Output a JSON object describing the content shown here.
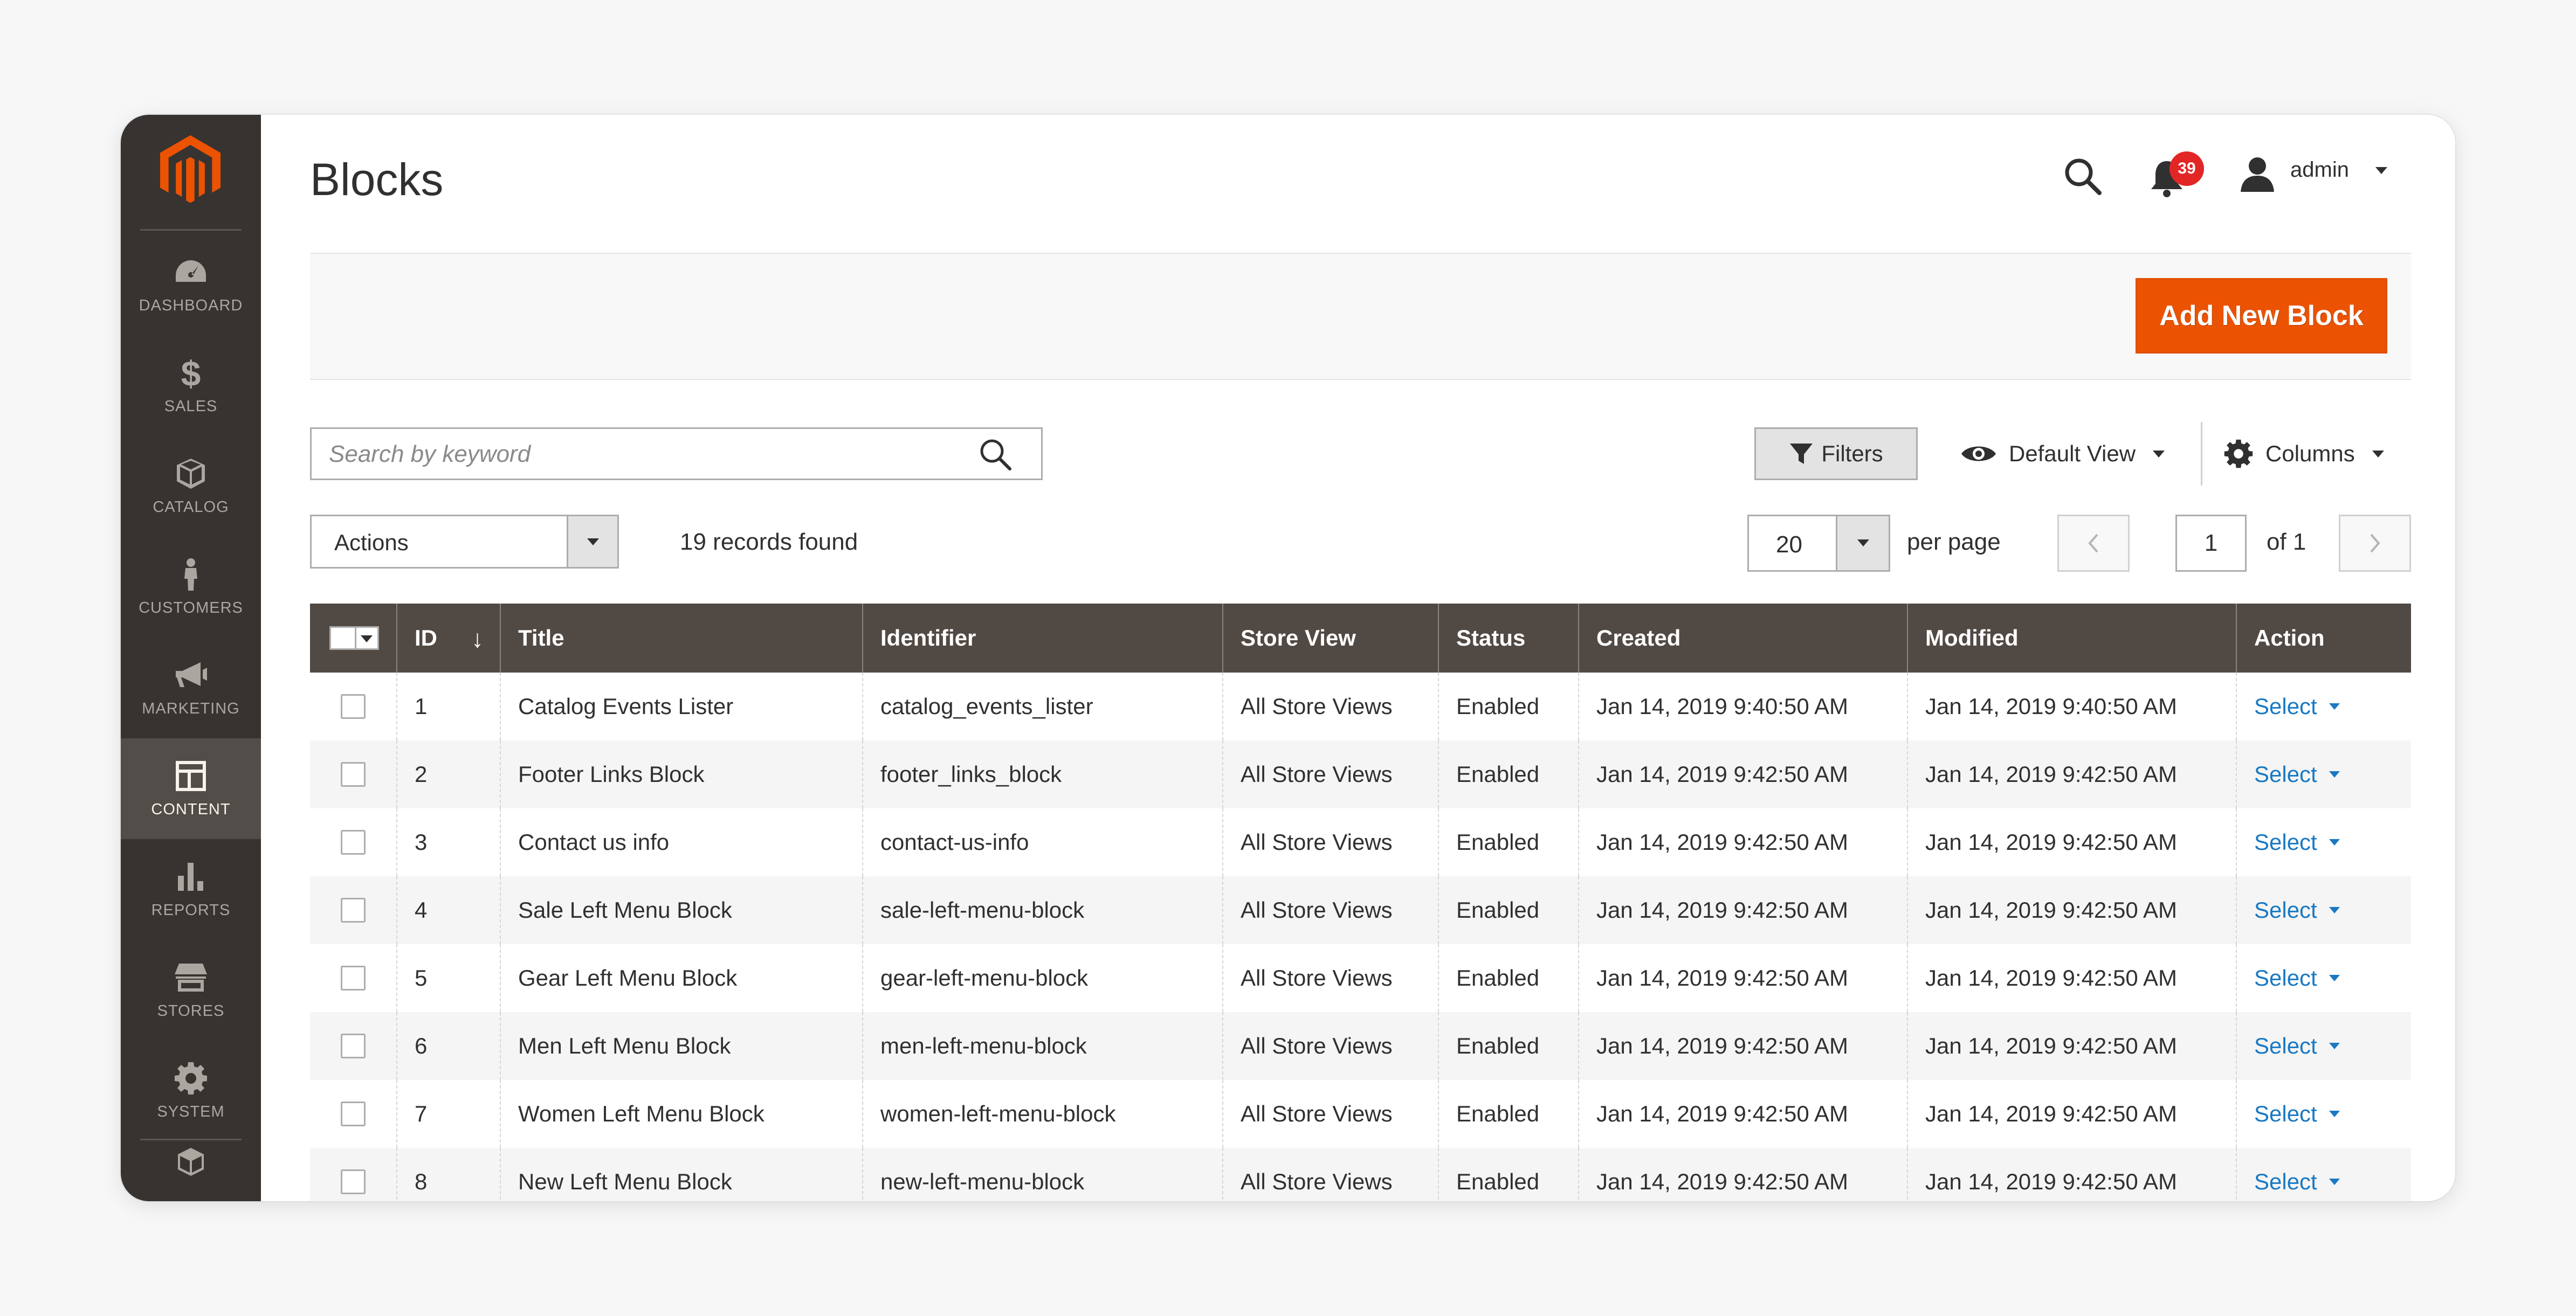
{
  "sidebar": {
    "items": [
      {
        "label": "DASHBOARD",
        "icon": "dashboard-icon"
      },
      {
        "label": "SALES",
        "icon": "dollar-icon"
      },
      {
        "label": "CATALOG",
        "icon": "cube-icon"
      },
      {
        "label": "CUSTOMERS",
        "icon": "person-icon"
      },
      {
        "label": "MARKETING",
        "icon": "megaphone-icon"
      },
      {
        "label": "CONTENT",
        "icon": "layout-icon",
        "active": true
      },
      {
        "label": "REPORTS",
        "icon": "bar-chart-icon"
      },
      {
        "label": "STORES",
        "icon": "storefront-icon"
      },
      {
        "label": "SYSTEM",
        "icon": "gear-icon"
      }
    ]
  },
  "header": {
    "title": "Blocks",
    "notification_count": "39",
    "username": "admin"
  },
  "page_actions": {
    "add_button": "Add New Block"
  },
  "toolbar": {
    "search_placeholder": "Search by keyword",
    "filters_label": "Filters",
    "view_label": "Default View",
    "columns_label": "Columns",
    "actions_label": "Actions",
    "records_found": "19 records found",
    "per_page_value": "20",
    "per_page_label": "per page",
    "page_number": "1",
    "page_of": "of 1"
  },
  "grid": {
    "columns": [
      "ID",
      "Title",
      "Identifier",
      "Store View",
      "Status",
      "Created",
      "Modified",
      "Action"
    ],
    "rows": [
      {
        "id": "1",
        "title": "Catalog Events Lister",
        "identifier": "catalog_events_lister",
        "store_view": "All Store Views",
        "status": "Enabled",
        "created": "Jan 14, 2019 9:40:50 AM",
        "modified": "Jan 14, 2019 9:40:50 AM",
        "action": "Select"
      },
      {
        "id": "2",
        "title": "Footer Links Block",
        "identifier": "footer_links_block",
        "store_view": "All Store Views",
        "status": "Enabled",
        "created": "Jan 14, 2019 9:42:50 AM",
        "modified": "Jan 14, 2019 9:42:50 AM",
        "action": "Select"
      },
      {
        "id": "3",
        "title": "Contact us info",
        "identifier": "contact-us-info",
        "store_view": "All Store Views",
        "status": "Enabled",
        "created": "Jan 14, 2019 9:42:50 AM",
        "modified": "Jan 14, 2019 9:42:50 AM",
        "action": "Select"
      },
      {
        "id": "4",
        "title": "Sale Left Menu Block",
        "identifier": "sale-left-menu-block",
        "store_view": "All Store Views",
        "status": "Enabled",
        "created": "Jan 14, 2019 9:42:50 AM",
        "modified": "Jan 14, 2019 9:42:50 AM",
        "action": "Select"
      },
      {
        "id": "5",
        "title": "Gear Left Menu Block",
        "identifier": "gear-left-menu-block",
        "store_view": "All Store Views",
        "status": "Enabled",
        "created": "Jan 14, 2019 9:42:50 AM",
        "modified": "Jan 14, 2019 9:42:50 AM",
        "action": "Select"
      },
      {
        "id": "6",
        "title": "Men Left Menu Block",
        "identifier": "men-left-menu-block",
        "store_view": "All Store Views",
        "status": "Enabled",
        "created": "Jan 14, 2019 9:42:50 AM",
        "modified": "Jan 14, 2019 9:42:50 AM",
        "action": "Select"
      },
      {
        "id": "7",
        "title": "Women Left Menu Block",
        "identifier": "women-left-menu-block",
        "store_view": "All Store Views",
        "status": "Enabled",
        "created": "Jan 14, 2019 9:42:50 AM",
        "modified": "Jan 14, 2019 9:42:50 AM",
        "action": "Select"
      },
      {
        "id": "8",
        "title": "New Left Menu Block",
        "identifier": "new-left-menu-block",
        "store_view": "All Store Views",
        "status": "Enabled",
        "created": "Jan 14, 2019 9:42:50 AM",
        "modified": "Jan 14, 2019 9:42:50 AM",
        "action": "Select"
      }
    ]
  },
  "colors": {
    "sidebar_bg": "#373330",
    "sidebar_active": "#524d49",
    "accent": "#eb5202",
    "grid_header": "#514943",
    "link": "#1979c3",
    "badge": "#e22626"
  }
}
